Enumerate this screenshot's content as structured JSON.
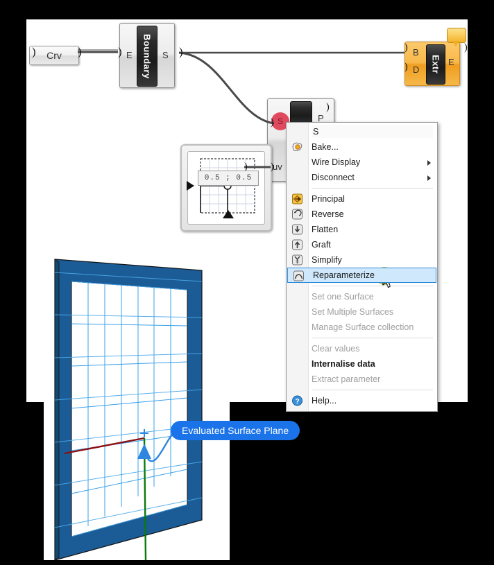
{
  "app": {
    "name": "Grasshopper canvas with context menu",
    "canvas_bg": "#ffffff",
    "page_bg": "#000000"
  },
  "components": {
    "curve_param": {
      "label": "Crv",
      "name": "curve-parameter"
    },
    "boundary": {
      "title": "Boundary",
      "input_label": "E",
      "output_label": "S",
      "name": "boundary-surfaces-component"
    },
    "extrude": {
      "title": "Extr",
      "input_labels": [
        "B",
        "D"
      ],
      "output_label": "E",
      "color": "#f3a72b",
      "warning_icon": "warning-balloon-icon",
      "name": "extrude-component"
    },
    "md_slider": {
      "value": "0.5 ; 0.5",
      "name": "md-slider"
    },
    "surface_eval": {
      "input_labels": [
        "S",
        "uv"
      ],
      "output_label": "P",
      "selected_input": "S",
      "selected_color": "#e04a5f",
      "name": "evaluate-surface-component"
    }
  },
  "context_menu": {
    "field_value": "S",
    "items": [
      {
        "label": "Bake...",
        "icon": "bake-icon",
        "enabled": true,
        "bold": false,
        "submenu": false,
        "highlighted": false
      },
      {
        "label": "Wire Display",
        "icon": "none",
        "enabled": true,
        "bold": false,
        "submenu": true,
        "highlighted": false
      },
      {
        "label": "Disconnect",
        "icon": "none",
        "enabled": true,
        "bold": false,
        "submenu": true,
        "highlighted": false
      },
      {
        "label": "Principal",
        "icon": "principal-icon",
        "enabled": true,
        "bold": false,
        "submenu": false,
        "highlighted": false
      },
      {
        "label": "Reverse",
        "icon": "reverse-icon",
        "enabled": true,
        "bold": false,
        "submenu": false,
        "highlighted": false
      },
      {
        "label": "Flatten",
        "icon": "flatten-icon",
        "enabled": true,
        "bold": false,
        "submenu": false,
        "highlighted": false
      },
      {
        "label": "Graft",
        "icon": "graft-icon",
        "enabled": true,
        "bold": false,
        "submenu": false,
        "highlighted": false
      },
      {
        "label": "Simplify",
        "icon": "simplify-icon",
        "enabled": true,
        "bold": false,
        "submenu": false,
        "highlighted": false
      },
      {
        "label": "Reparameterize",
        "icon": "reparameterize-icon",
        "enabled": true,
        "bold": false,
        "submenu": false,
        "highlighted": true
      },
      {
        "label": "Set one Surface",
        "icon": "none",
        "enabled": false,
        "bold": false,
        "submenu": false,
        "highlighted": false
      },
      {
        "label": "Set Multiple Surfaces",
        "icon": "none",
        "enabled": false,
        "bold": false,
        "submenu": false,
        "highlighted": false
      },
      {
        "label": "Manage Surface collection",
        "icon": "none",
        "enabled": false,
        "bold": false,
        "submenu": false,
        "highlighted": false
      },
      {
        "label": "Clear values",
        "icon": "none",
        "enabled": false,
        "bold": false,
        "submenu": false,
        "highlighted": false
      },
      {
        "label": "Internalise data",
        "icon": "none",
        "enabled": true,
        "bold": true,
        "submenu": false,
        "highlighted": false
      },
      {
        "label": "Extract parameter",
        "icon": "none",
        "enabled": false,
        "bold": false,
        "submenu": false,
        "highlighted": false
      },
      {
        "label": "Help...",
        "icon": "help-icon",
        "enabled": true,
        "bold": false,
        "submenu": false,
        "highlighted": false
      }
    ],
    "highlight_color": "#cfe8fb",
    "highlight_border": "#2e8ad8"
  },
  "viewport": {
    "callout": "Evaluated Surface Plane",
    "callout_color": "#1a73e8",
    "surface_color": "#1b5c96",
    "isocurve_color": "#3aa0e8",
    "x_axis_color": "#8b0f12",
    "y_axis_color": "#0a7a0a",
    "name": "rhino-viewport"
  },
  "pointer": {
    "click_indicator_color": "#9fc93c",
    "name": "mouse-cursor"
  }
}
